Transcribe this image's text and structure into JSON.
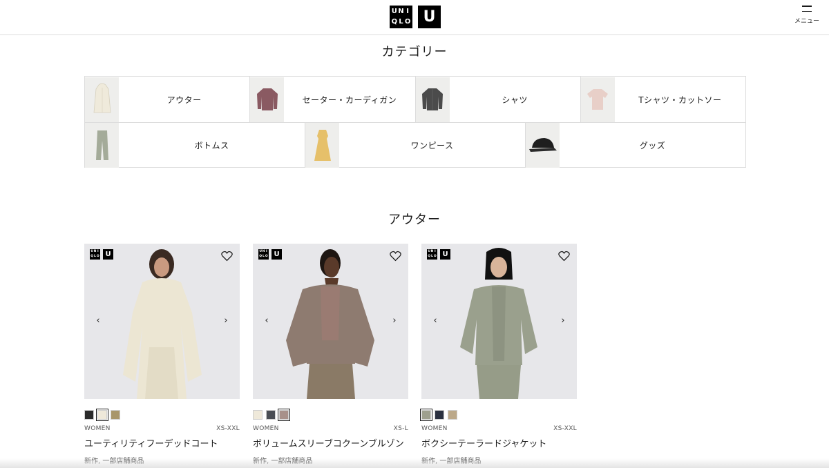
{
  "header": {
    "logo_uniqlo_letters": [
      "U",
      "N",
      "I",
      "Q",
      "L",
      "O"
    ],
    "logo_u": "U",
    "menu_label": "メニュー"
  },
  "categories_section": {
    "title": "カテゴリー",
    "rows": [
      [
        {
          "label": "アウター",
          "icon": "coat-icon",
          "color": "#efeadb"
        },
        {
          "label": "セーター・カーディガン",
          "icon": "sweater-icon",
          "color": "#8a5a62"
        },
        {
          "label": "シャツ",
          "icon": "shirt-icon",
          "color": "#4b4b4b"
        },
        {
          "label": "Tシャツ・カットソー",
          "icon": "tshirt-icon",
          "color": "#e8cfc8"
        }
      ],
      [
        {
          "label": "ボトムス",
          "icon": "pants-icon",
          "color": "#a4ab99"
        },
        {
          "label": "ワンピース",
          "icon": "dress-icon",
          "color": "#e6c06a"
        },
        {
          "label": "グッズ",
          "icon": "cap-icon",
          "color": "#1e1e1e"
        }
      ]
    ]
  },
  "outer_section": {
    "title": "アウター",
    "products": [
      {
        "name": "ユーティリティフーデッドコート",
        "gender": "WOMEN",
        "size": "XS-XXL",
        "note": "新作, 一部店舗商品",
        "garment_color": "#ece6d3",
        "swatches": [
          "#2a2a2a",
          "#efe9da",
          "#a8966b"
        ],
        "selected_swatch": 1
      },
      {
        "name": "ボリュームスリーブコクーンブルゾン",
        "gender": "WOMEN",
        "size": "XS-L",
        "note": "新作, 一部店舗商品",
        "garment_color": "#8e7b70",
        "swatches": [
          "#efe9da",
          "#4a4e55",
          "#a8918a"
        ],
        "selected_swatch": 2
      },
      {
        "name": "ボクシーテーラードジャケット",
        "gender": "WOMEN",
        "size": "XS-XXL",
        "note": "新作, 一部店舗商品",
        "garment_color": "#9aa08d",
        "swatches": [
          "#9ea08f",
          "#2a3040",
          "#bca98a"
        ],
        "selected_swatch": 0
      }
    ]
  }
}
